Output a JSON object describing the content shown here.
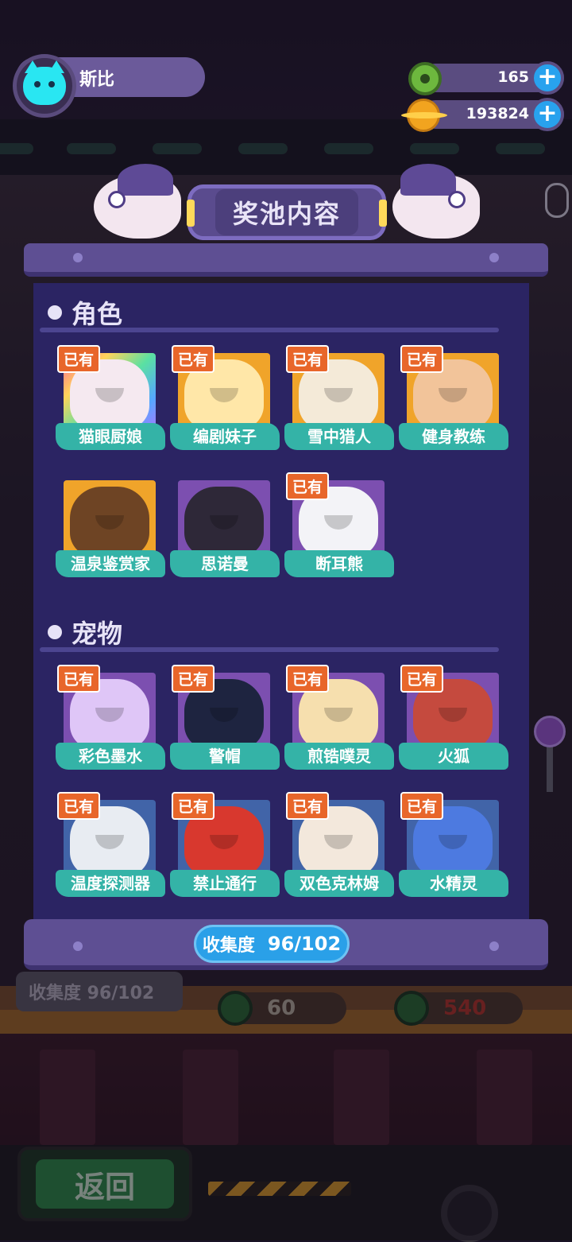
{
  "player": {
    "name": "斯比",
    "avatar_icon": "cat-avatar-icon"
  },
  "currencies": {
    "donut": {
      "value": "165",
      "icon": "donut-coin-icon"
    },
    "planet": {
      "value": "193824",
      "icon": "planet-coin-icon"
    }
  },
  "modal": {
    "title": "奖池内容",
    "sections": [
      {
        "title": "角色",
        "items": [
          {
            "name": "猫眼厨娘",
            "owned": true,
            "owned_label": "已有",
            "frame": "rainbow",
            "art": "#f5e9f0"
          },
          {
            "name": "编剧妹子",
            "owned": true,
            "owned_label": "已有",
            "frame": "gold",
            "art": "#ffe7a8"
          },
          {
            "name": "雪中猎人",
            "owned": true,
            "owned_label": "已有",
            "frame": "gold",
            "art": "#f4ead8"
          },
          {
            "name": "健身教练",
            "owned": true,
            "owned_label": "已有",
            "frame": "gold",
            "art": "#f2c49a"
          },
          {
            "name": "温泉鉴赏家",
            "owned": false,
            "owned_label": "",
            "frame": "gold",
            "art": "#6e4424"
          },
          {
            "name": "思诺曼",
            "owned": false,
            "owned_label": "",
            "frame": "violet",
            "art": "#2e2838"
          },
          {
            "name": "断耳熊",
            "owned": true,
            "owned_label": "已有",
            "frame": "violet",
            "art": "#f3f3f7"
          }
        ]
      },
      {
        "title": "宠物",
        "items": [
          {
            "name": "彩色墨水",
            "owned": true,
            "owned_label": "已有",
            "frame": "violet",
            "art": "#dfc6f7"
          },
          {
            "name": "警帽",
            "owned": true,
            "owned_label": "已有",
            "frame": "violet",
            "art": "#1e2440"
          },
          {
            "name": "煎锆噗灵",
            "owned": true,
            "owned_label": "已有",
            "frame": "violet",
            "art": "#f6dfae"
          },
          {
            "name": "火狐",
            "owned": true,
            "owned_label": "已有",
            "frame": "violet",
            "art": "#c54a3e"
          },
          {
            "name": "温度探测器",
            "owned": true,
            "owned_label": "已有",
            "frame": "blue",
            "art": "#e8ecf2"
          },
          {
            "name": "禁止通行",
            "owned": true,
            "owned_label": "已有",
            "frame": "blue",
            "art": "#d8382e"
          },
          {
            "name": "双色克林姆",
            "owned": true,
            "owned_label": "已有",
            "frame": "blue",
            "art": "#f3e8dc"
          },
          {
            "name": "水精灵",
            "owned": true,
            "owned_label": "已有",
            "frame": "blue",
            "art": "#4d7ae0"
          }
        ]
      }
    ],
    "collection": {
      "label": "收集度",
      "value": "96/102"
    }
  },
  "background": {
    "collection_label": "收集度 96/102",
    "cost_single": "60",
    "cost_multi": "540"
  },
  "back_button": {
    "label": "返回"
  },
  "colors": {
    "owned_tag": "#e8662a",
    "name_plate": "#34b3a7",
    "panel": "#2b2463",
    "collect_pill": "#2aa0e8",
    "back_button": "#2f8a4a"
  }
}
